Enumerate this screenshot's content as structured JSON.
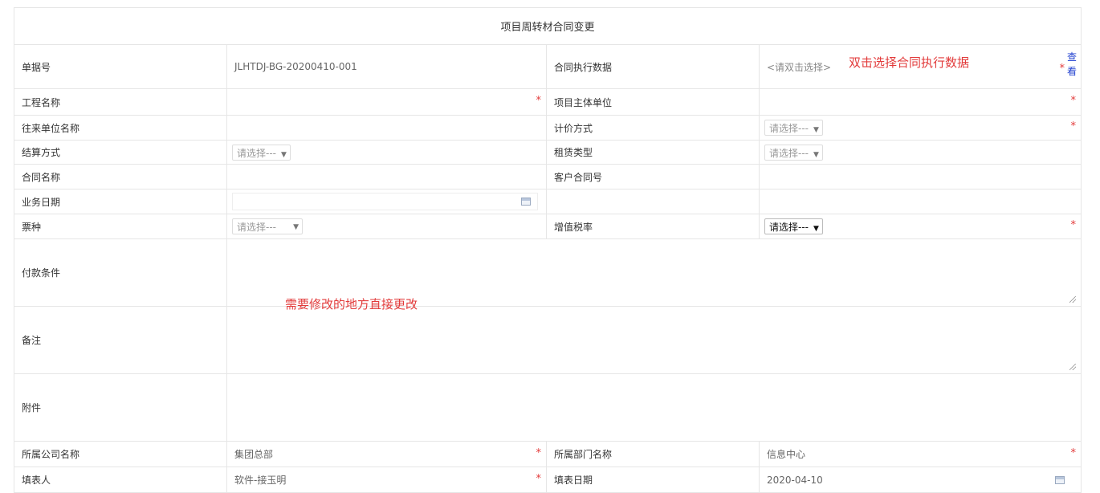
{
  "form": {
    "title": "项目周转材合同变更",
    "required_mark": "*",
    "fields": {
      "doc_no": {
        "label": "单据号",
        "value": "JLHTDJ-BG-20200410-001"
      },
      "contract_exec": {
        "label": "合同执行数据",
        "placeholder": "<请双击选择>",
        "link_char1": "查",
        "link_char2": "看"
      },
      "project_name": {
        "label": "工程名称",
        "value": ""
      },
      "project_main_unit": {
        "label": "项目主体单位",
        "value": ""
      },
      "partner_name": {
        "label": "往来单位名称",
        "value": ""
      },
      "pricing_method": {
        "label": "计价方式",
        "select": "请选择---"
      },
      "settlement": {
        "label": "结算方式",
        "select": "请选择---"
      },
      "lease_type": {
        "label": "租赁类型",
        "select": "请选择---"
      },
      "contract_name": {
        "label": "合同名称",
        "value": ""
      },
      "customer_contract_no": {
        "label": "客户合同号",
        "value": ""
      },
      "business_date": {
        "label": "业务日期",
        "value": ""
      },
      "ticket_type": {
        "label": "票种",
        "select": "请选择---"
      },
      "vat_rate": {
        "label": "增值税率",
        "select": "请选择---"
      },
      "payment_terms": {
        "label": "付款条件",
        "value": ""
      },
      "remarks": {
        "label": "备注",
        "value": ""
      },
      "attachments": {
        "label": "附件"
      },
      "company_name": {
        "label": "所属公司名称",
        "value": "集团总部"
      },
      "department_name": {
        "label": "所属部门名称",
        "value": "信息中心"
      },
      "filler": {
        "label": "填表人",
        "value": "软件-接玉明"
      },
      "fill_date": {
        "label": "填表日期",
        "value": "2020-04-10"
      }
    }
  },
  "annotations": {
    "double_click_hint": "双击选择合同执行数据",
    "edit_hint": "需要修改的地方直接更改"
  }
}
